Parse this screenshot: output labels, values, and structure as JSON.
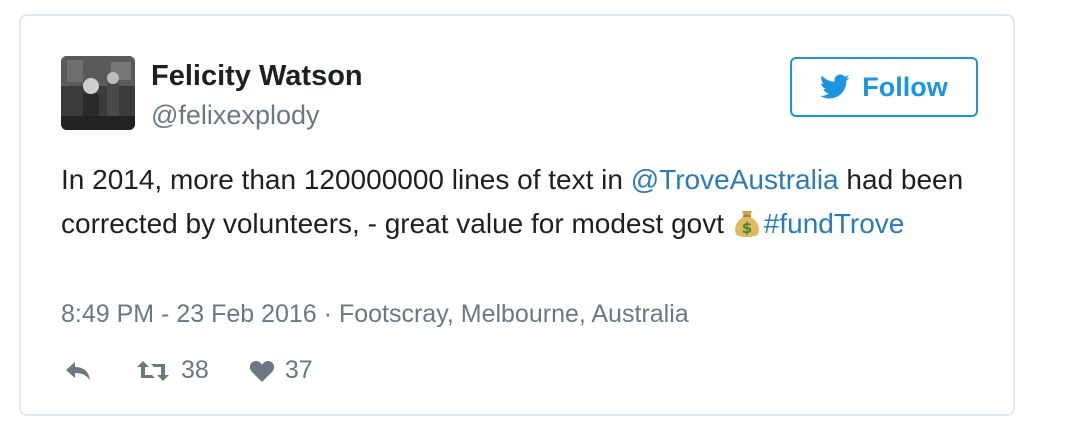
{
  "author": {
    "name": "Felicity Watson",
    "handle": "@felixexplody"
  },
  "follow_button": {
    "label": "Follow",
    "icon": "twitter-bird-icon"
  },
  "tweet": {
    "text_part1": "In 2014, more than 120000000 lines of text in ",
    "mention": "@TroveAustralia",
    "text_part2": " had been corrected by volunteers, - great value for modest govt ",
    "emoji_icon": "money-bag-icon",
    "hashtag": "#fundTrove"
  },
  "meta": {
    "time": "8:49 PM - 23 Feb 2016",
    "separator": "·",
    "location": "Footscray, Melbourne, Australia"
  },
  "actions": {
    "reply_icon": "reply-icon",
    "retweet_icon": "retweet-icon",
    "retweet_count": "38",
    "like_icon": "heart-icon",
    "like_count": "37"
  },
  "colors": {
    "accent": "#1b95e0",
    "link": "#2b7bb9",
    "text": "#1c2022",
    "secondary": "#697882",
    "border": "#e1e8ed"
  }
}
